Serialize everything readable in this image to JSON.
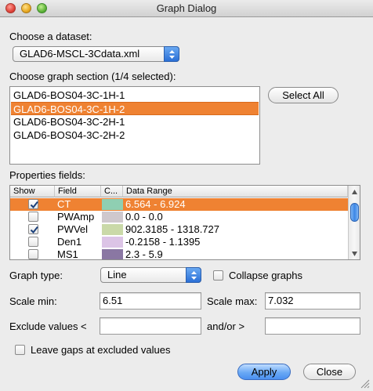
{
  "window": {
    "title": "Graph Dialog"
  },
  "dataset": {
    "label": "Choose a dataset:",
    "selected": "GLAD6-MSCL-3Cdata.xml"
  },
  "sections": {
    "label": "Choose graph section (1/4 selected):",
    "items": [
      {
        "label": "GLAD6-BOS04-3C-1H-1",
        "selected": false
      },
      {
        "label": "GLAD6-BOS04-3C-1H-2",
        "selected": true
      },
      {
        "label": "GLAD6-BOS04-3C-2H-1",
        "selected": false
      },
      {
        "label": "GLAD6-BOS04-3C-2H-2",
        "selected": false
      }
    ],
    "select_all": "Select All"
  },
  "properties": {
    "label": "Properties fields:",
    "columns": {
      "show": "Show",
      "field": "Field",
      "color": "C...",
      "range": "Data Range"
    },
    "rows": [
      {
        "show": true,
        "field": "CT",
        "color": "#8fcfb2",
        "range": "6.564 - 6.924",
        "selected": true
      },
      {
        "show": false,
        "field": "PWAmp",
        "color": "#cfc8cd",
        "range": "0.0 - 0.0",
        "selected": false
      },
      {
        "show": true,
        "field": "PWVel",
        "color": "#cad9a8",
        "range": "902.3185 - 1318.727",
        "selected": false
      },
      {
        "show": false,
        "field": "Den1",
        "color": "#dcc4e6",
        "range": "-0.2158 - 1.1395",
        "selected": false
      },
      {
        "show": false,
        "field": "MS1",
        "color": "#8a77a3",
        "range": "2.3 - 5.9",
        "selected": false
      }
    ]
  },
  "graph_type": {
    "label": "Graph type:",
    "selected": "Line",
    "collapse_label": "Collapse graphs",
    "collapse": false
  },
  "scale": {
    "min_label": "Scale min:",
    "min_value": "6.51",
    "max_label": "Scale max:",
    "max_value": "7.032"
  },
  "exclude": {
    "label": "Exclude values <",
    "less_value": "",
    "or_label": "and/or >",
    "greater_value": ""
  },
  "gaps": {
    "label": "Leave gaps at excluded values",
    "checked": false
  },
  "buttons": {
    "apply": "Apply",
    "close": "Close"
  },
  "colors": {
    "selection": "#ef8232",
    "accent": "#4a8ff0"
  }
}
